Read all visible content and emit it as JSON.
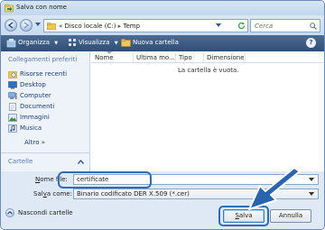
{
  "window": {
    "title": "Salva con nome"
  },
  "address": {
    "prefix": "«",
    "crumbs": [
      "Disco locale (C:)",
      "Temp"
    ],
    "separator": "▸",
    "search_placeholder": "Cerca"
  },
  "toolbar": {
    "organize": "Organizza",
    "views": "Visualizza",
    "new_folder": "Nuova cartella",
    "dropdown_glyph": "▼",
    "help": "?"
  },
  "nav": {
    "header": "Collegamenti preferiti",
    "items": [
      {
        "label": "Risorse recenti",
        "icon": "recent-places-icon"
      },
      {
        "label": "Desktop",
        "icon": "desktop-icon"
      },
      {
        "label": "Computer",
        "icon": "computer-icon"
      },
      {
        "label": "Documenti",
        "icon": "documents-icon"
      },
      {
        "label": "Immagini",
        "icon": "pictures-icon"
      },
      {
        "label": "Musica",
        "icon": "music-icon"
      }
    ],
    "more": "Altro »",
    "footer": "Cartelle"
  },
  "columns": [
    "Nome",
    "Ultima mo...",
    "Tipo",
    "Dimensione"
  ],
  "empty_message": "La cartella è vuota.",
  "form": {
    "filename_label": {
      "pre": "",
      "accel": "N",
      "post": "ome file:"
    },
    "filename_value": "certificate",
    "type_label": {
      "pre": "Sal",
      "accel": "v",
      "post": "a come:"
    },
    "type_value": "Binario codificato DER X.509 (*.cer)"
  },
  "footer": {
    "hide_folders": "Nascondi cartelle",
    "save": {
      "pre": "",
      "accel": "S",
      "post": "alva"
    },
    "cancel": "Annulla"
  },
  "colors": {
    "toolbar_bg": "#3b5a82",
    "highlight": "#2f6cb4",
    "arrow": "#2a64ad"
  }
}
